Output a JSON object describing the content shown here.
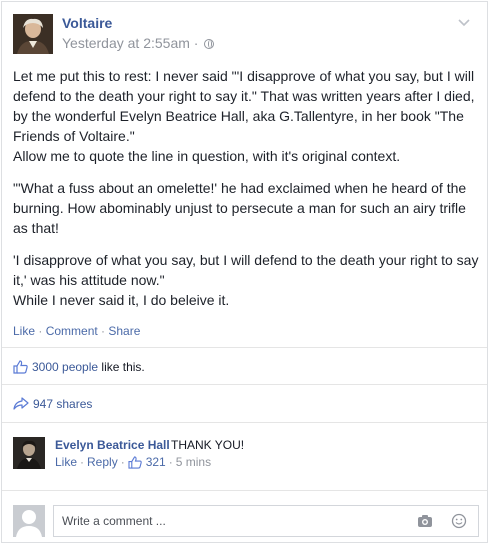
{
  "post": {
    "author": "Voltaire",
    "timestamp": "Yesterday at 2:55am",
    "separator": " · ",
    "paragraphs": [
      "Let me put this to rest: I never said \"'I disapprove of what you say, but I will defend to the death your right to say it.\" That was written years after I died, by the wonderful Evelyn Beatrice Hall, aka G.Tallentyre, in her book \"The Friends of Voltaire.\"\nAllow me to quote the line in question, with it's original context.",
      "\"'What a fuss about an omelette!' he had exclaimed when he heard of the burning. How abominably unjust to persecute a man for such an airy trifle as that!",
      "'I disapprove of what you say, but I will defend to the death your right to say it,' was his attitude now.\"\nWhile I never said it, I do beleive it."
    ],
    "actions": {
      "like": "Like",
      "comment": "Comment",
      "share": "Share",
      "sep": " · "
    }
  },
  "reactions": {
    "likes_link": "3000 people",
    "likes_suffix": " like this.",
    "shares": "947 shares"
  },
  "comment": {
    "author": "Evelyn Beatrice Hall",
    "text": "THANK YOU!",
    "like": "Like",
    "reply": "Reply",
    "like_count": "321",
    "time": "5 mins",
    "sep": "·"
  },
  "composer": {
    "placeholder": "Write a comment ..."
  },
  "icons": {
    "chevron": "chevron-down-icon",
    "globe": "globe-icon",
    "thumbs_up": "thumbs-up-icon",
    "share": "share-arrow-icon",
    "camera": "camera-icon",
    "emoji": "smiley-icon"
  },
  "colors": {
    "link": "#3b5998",
    "muted": "#90949c",
    "text": "#1d2129"
  }
}
